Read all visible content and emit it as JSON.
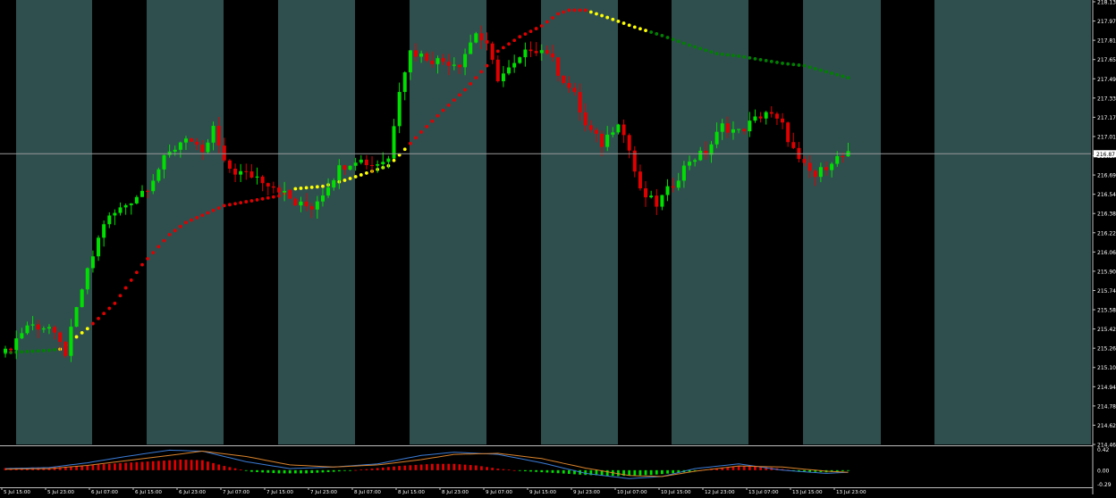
{
  "colors": {
    "background": "#000000",
    "session_band": "#2f4f4f",
    "bull_candle": "#00e000",
    "bear_candle": "#e00000",
    "ma_up": "#e00000",
    "ma_neutral": "#ffff00",
    "ma_down": "#008000",
    "hist_pos": "#e00000",
    "hist_neg": "#00e000",
    "osc_line_1": "#3a7bd5",
    "osc_line_2": "#d9822b",
    "axis_text": "#ffffff",
    "price_line": "#9a9a9a"
  },
  "current_price_label": "216.87",
  "chart_data": [
    {
      "type": "candlestick",
      "title": "",
      "ylim": [
        214.46,
        218.13
      ],
      "y_ticks": [
        "218.13",
        "217.97",
        "217.81",
        "217.65",
        "217.49",
        "217.33",
        "217.17",
        "217.01",
        "216.87",
        "216.69",
        "216.54",
        "216.38",
        "216.22",
        "216.06",
        "215.90",
        "215.74",
        "215.58",
        "215.42",
        "215.26",
        "215.10",
        "214.94",
        "214.78",
        "214.62",
        "214.46"
      ],
      "x_ticks": [
        "5 Jul 15:00",
        "5 Jul 23:00",
        "6 Jul 07:00",
        "6 Jul 15:00",
        "6 Jul 23:00",
        "7 Jul 07:00",
        "7 Jul 15:00",
        "7 Jul 23:00",
        "8 Jul 07:00",
        "8 Jul 15:00",
        "8 Jul 23:00",
        "9 Jul 07:00",
        "9 Jul 15:00",
        "9 Jul 23:00",
        "10 Jul 07:00",
        "10 Jul 15:00",
        "12 Jul 23:00",
        "13 Jul 07:00",
        "13 Jul 15:00",
        "13 Jul 23:00"
      ],
      "current_price": 216.87,
      "close_path": [
        [
          0,
          215.22
        ],
        [
          4,
          215.45
        ],
        [
          8,
          215.43
        ],
        [
          9,
          215.35
        ],
        [
          11,
          215.22
        ],
        [
          14,
          215.75
        ],
        [
          18,
          216.3
        ],
        [
          22,
          216.45
        ],
        [
          26,
          216.6
        ],
        [
          29,
          216.82
        ],
        [
          33,
          217.02
        ],
        [
          36,
          216.85
        ],
        [
          38,
          217.08
        ],
        [
          40,
          216.78
        ],
        [
          42,
          216.72
        ],
        [
          46,
          216.68
        ],
        [
          50,
          216.58
        ],
        [
          53,
          216.45
        ],
        [
          56,
          216.43
        ],
        [
          58,
          216.55
        ],
        [
          61,
          216.75
        ],
        [
          64,
          216.83
        ],
        [
          67,
          216.78
        ],
        [
          70,
          216.83
        ],
        [
          72,
          217.42
        ],
        [
          74,
          217.72
        ],
        [
          78,
          217.65
        ],
        [
          83,
          217.62
        ],
        [
          86,
          217.88
        ],
        [
          88,
          217.75
        ],
        [
          90,
          217.5
        ],
        [
          93,
          217.6
        ],
        [
          96,
          217.75
        ],
        [
          99,
          217.72
        ],
        [
          101,
          217.55
        ],
        [
          104,
          217.35
        ],
        [
          106,
          217.1
        ],
        [
          109,
          216.95
        ],
        [
          112,
          217.15
        ],
        [
          114,
          216.9
        ],
        [
          116,
          216.55
        ],
        [
          119,
          216.45
        ],
        [
          122,
          216.62
        ],
        [
          125,
          216.82
        ],
        [
          128,
          216.88
        ],
        [
          131,
          217.1
        ],
        [
          134,
          217.05
        ],
        [
          136,
          217.12
        ],
        [
          139,
          217.22
        ],
        [
          142,
          217.1
        ],
        [
          145,
          216.8
        ],
        [
          148,
          216.68
        ],
        [
          151,
          216.82
        ],
        [
          154,
          216.86
        ]
      ],
      "moving_average_path": [
        [
          0,
          215.22
        ],
        [
          8,
          215.24
        ],
        [
          10,
          215.25
        ],
        [
          15,
          215.42
        ],
        [
          20,
          215.63
        ],
        [
          25,
          215.95
        ],
        [
          30,
          216.2
        ],
        [
          33,
          216.3
        ],
        [
          36,
          216.36
        ],
        [
          40,
          216.44
        ],
        [
          45,
          216.48
        ],
        [
          50,
          216.52
        ],
        [
          53,
          216.58
        ],
        [
          58,
          216.6
        ],
        [
          62,
          216.65
        ],
        [
          66,
          216.71
        ],
        [
          70,
          216.77
        ],
        [
          72,
          216.86
        ],
        [
          76,
          217.05
        ],
        [
          80,
          217.23
        ],
        [
          84,
          217.4
        ],
        [
          88,
          217.6
        ],
        [
          90,
          217.72
        ],
        [
          94,
          217.84
        ],
        [
          98,
          217.93
        ],
        [
          101,
          218.03
        ],
        [
          103,
          218.06
        ],
        [
          106,
          218.06
        ],
        [
          110,
          218.0
        ],
        [
          115,
          217.92
        ],
        [
          120,
          217.85
        ],
        [
          125,
          217.77
        ],
        [
          130,
          217.7
        ],
        [
          134,
          217.68
        ],
        [
          138,
          217.65
        ],
        [
          142,
          217.62
        ],
        [
          146,
          217.6
        ],
        [
          150,
          217.55
        ],
        [
          154,
          217.5
        ]
      ],
      "ma_segment_colors": [
        {
          "from": 0,
          "to": 9,
          "color": "green"
        },
        {
          "from": 10,
          "to": 15,
          "color": "yellow"
        },
        {
          "from": 16,
          "to": 52,
          "color": "red"
        },
        {
          "from": 53,
          "to": 73,
          "color": "yellow"
        },
        {
          "from": 74,
          "to": 106,
          "color": "red"
        },
        {
          "from": 107,
          "to": 117,
          "color": "yellow"
        },
        {
          "from": 118,
          "to": 154,
          "color": "green"
        }
      ]
    },
    {
      "type": "histogram",
      "title": "",
      "ylim": [
        -0.29,
        0.42
      ],
      "y_ticks": [
        "0.42",
        "0.00",
        "-0.29"
      ],
      "histogram_path": [
        [
          0,
          0.04
        ],
        [
          5,
          0.05
        ],
        [
          10,
          0.06
        ],
        [
          16,
          0.1
        ],
        [
          22,
          0.14
        ],
        [
          27,
          0.17
        ],
        [
          32,
          0.2
        ],
        [
          36,
          0.19
        ],
        [
          40,
          0.08
        ],
        [
          45,
          -0.03
        ],
        [
          50,
          -0.06
        ],
        [
          55,
          -0.06
        ],
        [
          60,
          -0.03
        ],
        [
          66,
          0.02
        ],
        [
          72,
          0.08
        ],
        [
          78,
          0.12
        ],
        [
          82,
          0.12
        ],
        [
          86,
          0.09
        ],
        [
          90,
          0.03
        ],
        [
          95,
          -0.02
        ],
        [
          100,
          -0.05
        ],
        [
          106,
          -0.09
        ],
        [
          112,
          -0.11
        ],
        [
          118,
          -0.09
        ],
        [
          124,
          -0.04
        ],
        [
          130,
          0.04
        ],
        [
          135,
          0.08
        ],
        [
          140,
          0.05
        ],
        [
          145,
          -0.02
        ],
        [
          150,
          -0.04
        ],
        [
          154,
          -0.01
        ]
      ],
      "signal_line_1_path": [
        [
          0,
          0.03
        ],
        [
          8,
          0.05
        ],
        [
          15,
          0.14
        ],
        [
          22,
          0.26
        ],
        [
          30,
          0.38
        ],
        [
          36,
          0.36
        ],
        [
          44,
          0.16
        ],
        [
          52,
          0.03
        ],
        [
          60,
          0.06
        ],
        [
          68,
          0.12
        ],
        [
          76,
          0.28
        ],
        [
          82,
          0.34
        ],
        [
          90,
          0.3
        ],
        [
          98,
          0.14
        ],
        [
          106,
          -0.06
        ],
        [
          114,
          -0.16
        ],
        [
          120,
          -0.12
        ],
        [
          126,
          0.03
        ],
        [
          134,
          0.12
        ],
        [
          142,
          0.0
        ],
        [
          150,
          -0.06
        ],
        [
          154,
          -0.04
        ]
      ],
      "signal_line_2_path": [
        [
          0,
          0.02
        ],
        [
          8,
          0.03
        ],
        [
          15,
          0.09
        ],
        [
          22,
          0.18
        ],
        [
          30,
          0.28
        ],
        [
          36,
          0.36
        ],
        [
          44,
          0.26
        ],
        [
          52,
          0.1
        ],
        [
          60,
          0.06
        ],
        [
          68,
          0.1
        ],
        [
          76,
          0.2
        ],
        [
          82,
          0.3
        ],
        [
          90,
          0.32
        ],
        [
          98,
          0.22
        ],
        [
          106,
          0.04
        ],
        [
          114,
          -0.1
        ],
        [
          120,
          -0.12
        ],
        [
          126,
          -0.02
        ],
        [
          134,
          0.08
        ],
        [
          142,
          0.06
        ],
        [
          150,
          -0.02
        ],
        [
          154,
          -0.04
        ]
      ]
    }
  ]
}
